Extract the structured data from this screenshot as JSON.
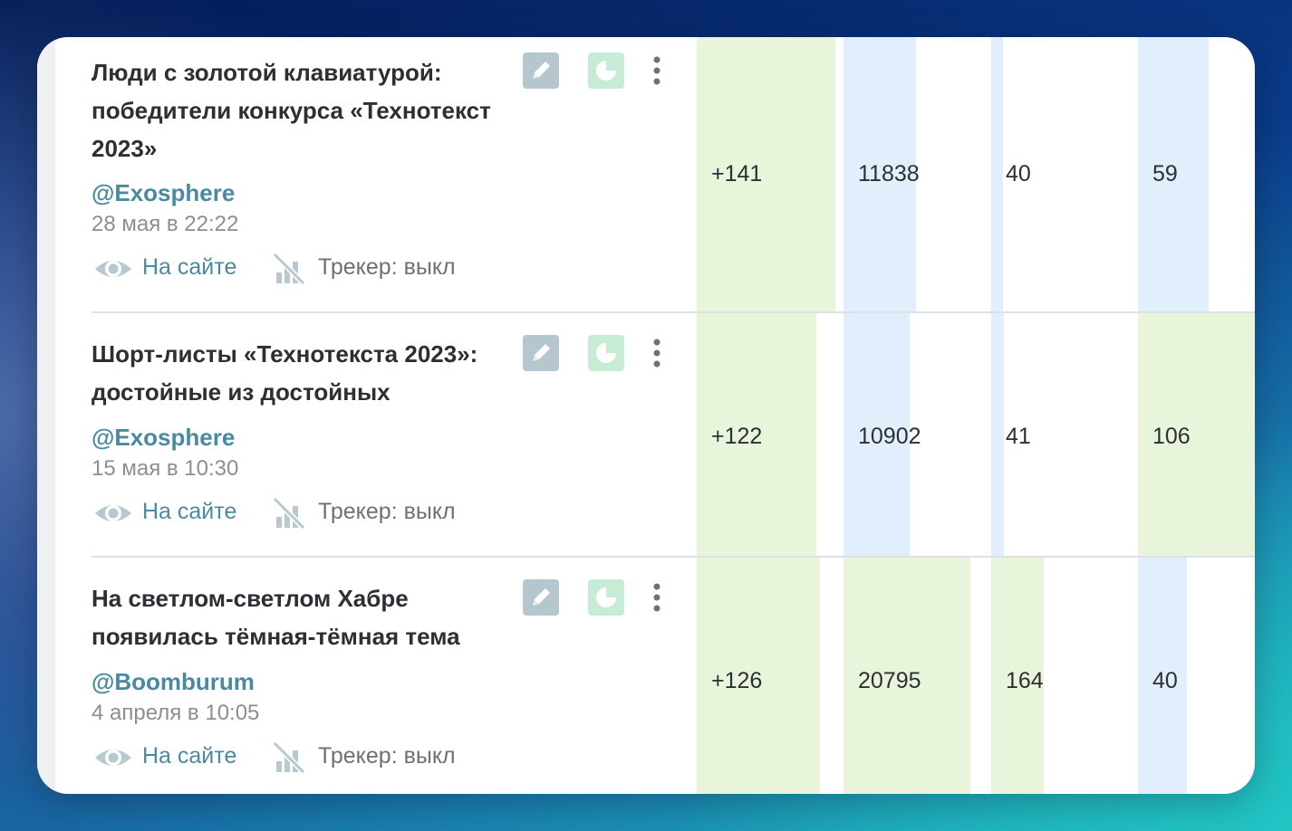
{
  "colors": {
    "green_bar": "#e9f5db",
    "blue_bar": "#e0effb",
    "author_link": "#4a8aa0",
    "edit_button": "#b6c6cf",
    "stats_button": "#c7ecd6"
  },
  "icons": {
    "edit": "pencil-icon",
    "stats": "pie-chart-icon",
    "more": "kebab-menu-icon",
    "visibility": "eye-icon",
    "tracker": "tracker-off-icon"
  },
  "articles": [
    {
      "title": "Люди с золотой клавиатурой: победители конкурса «Технотекст 2023»",
      "author": "@Exosphere",
      "date": "28 мая в 22:22",
      "visibility": "На сайте",
      "tracker": "Трекер: выкл",
      "rating": "+141",
      "views": "11838",
      "col3": "40",
      "col4": "59"
    },
    {
      "title": "Шорт-листы «Технотекста 2023»: достойные из достойных",
      "author": "@Exosphere",
      "date": "15 мая в 10:30",
      "visibility": "На сайте",
      "tracker": "Трекер: выкл",
      "rating": "+122",
      "views": "10902",
      "col3": "41",
      "col4": "106"
    },
    {
      "title": "На светлом-светлом Хабре появилась тёмная-тёмная тема",
      "author": "@Boomburum",
      "date": "4 апреля в 10:05",
      "visibility": "На сайте",
      "tracker": "Трекер: выкл",
      "rating": "+126",
      "views": "20795",
      "col3": "164",
      "col4": "40"
    }
  ]
}
